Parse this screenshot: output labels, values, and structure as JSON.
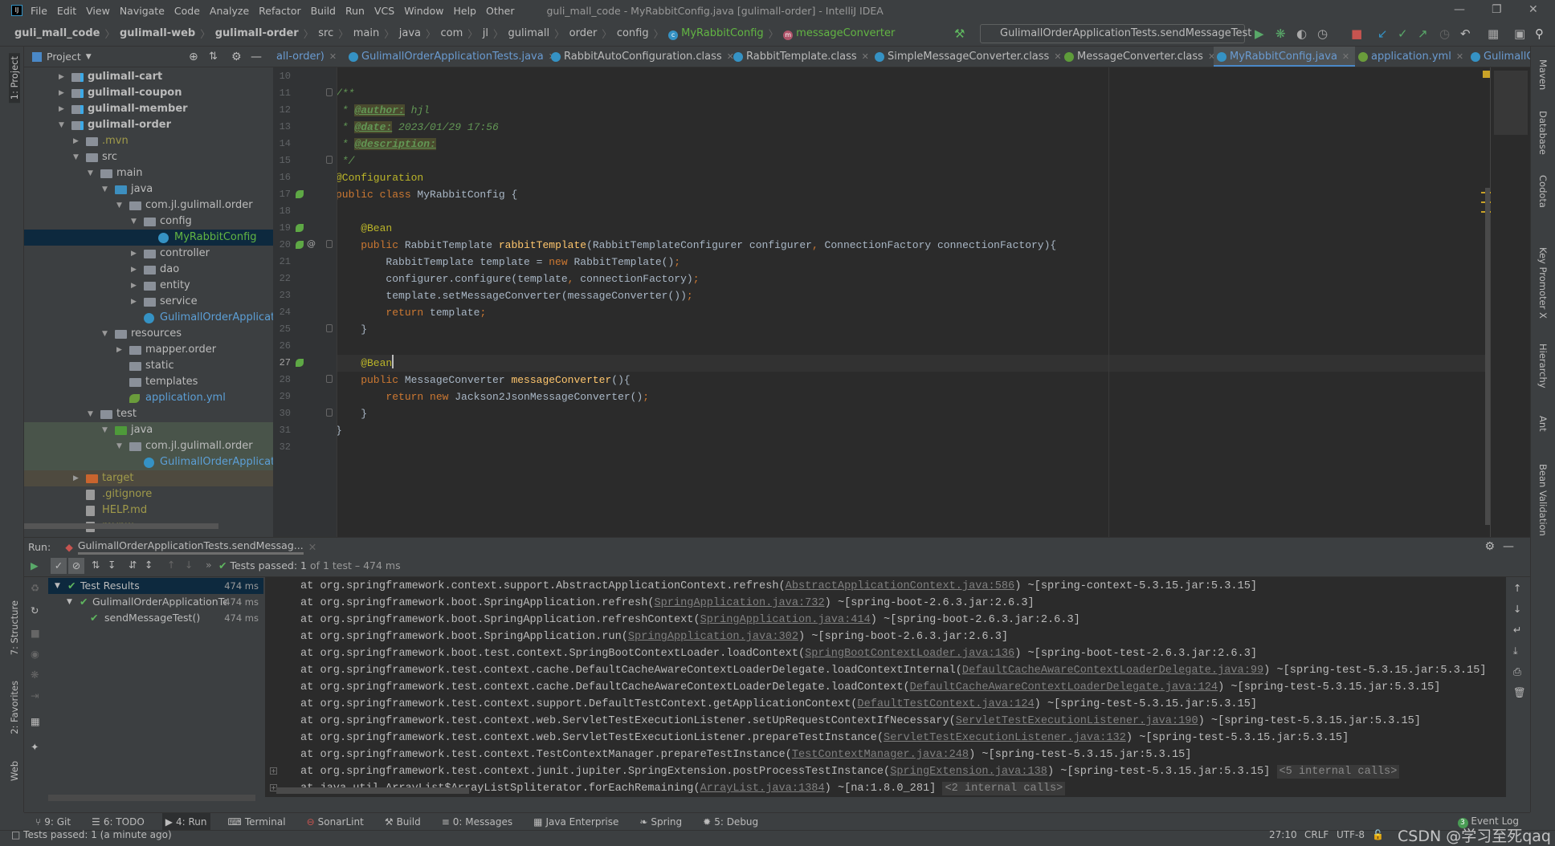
{
  "app": {
    "title": "guli_mall_code - MyRabbitConfig.java [gulimall-order] - IntelliJ IDEA",
    "logo": "IJ"
  },
  "menu": [
    "File",
    "Edit",
    "View",
    "Navigate",
    "Code",
    "Analyze",
    "Refactor",
    "Build",
    "Run",
    "VCS",
    "Window",
    "Help",
    "Other"
  ],
  "breadcrumb": [
    {
      "label": "guli_mall_code",
      "bold": true
    },
    {
      "label": "gulimall-web",
      "bold": true
    },
    {
      "label": "gulimall-order",
      "bold": true
    },
    {
      "label": "src"
    },
    {
      "label": "main"
    },
    {
      "label": "java"
    },
    {
      "label": "com"
    },
    {
      "label": "jl"
    },
    {
      "label": "gulimall"
    },
    {
      "label": "order"
    },
    {
      "label": "config"
    },
    {
      "label": "MyRabbitConfig",
      "icon": "class-icon"
    },
    {
      "label": "messageConverter",
      "icon": "method-icon"
    }
  ],
  "run_config": "GulimallOrderApplicationTests.sendMessageTest",
  "project": {
    "title": "Project",
    "tree": [
      {
        "label": "gulimall-cart",
        "depth": 0,
        "arrow": "right",
        "icon": "module",
        "bold": true
      },
      {
        "label": "gulimall-coupon",
        "depth": 0,
        "arrow": "right",
        "icon": "module",
        "bold": true
      },
      {
        "label": "gulimall-member",
        "depth": 0,
        "arrow": "right",
        "icon": "module",
        "bold": true
      },
      {
        "label": "gulimall-order",
        "depth": 0,
        "arrow": "down",
        "icon": "module",
        "bold": true
      },
      {
        "label": ".mvn",
        "depth": 1,
        "arrow": "right",
        "icon": "folder",
        "color": "#a09a4a"
      },
      {
        "label": "src",
        "depth": 1,
        "arrow": "down",
        "icon": "folder"
      },
      {
        "label": "main",
        "depth": 2,
        "arrow": "down",
        "icon": "folder"
      },
      {
        "label": "java",
        "depth": 3,
        "arrow": "down",
        "icon": "folder",
        "iconColor": "#3d8fbf"
      },
      {
        "label": "com.jl.gulimall.order",
        "depth": 4,
        "arrow": "down",
        "icon": "package"
      },
      {
        "label": "config",
        "depth": 5,
        "arrow": "down",
        "icon": "package"
      },
      {
        "label": "MyRabbitConfig",
        "depth": 6,
        "arrow": "",
        "icon": "class",
        "color": "#62b543",
        "selected": true
      },
      {
        "label": "controller",
        "depth": 5,
        "arrow": "right",
        "icon": "package"
      },
      {
        "label": "dao",
        "depth": 5,
        "arrow": "right",
        "icon": "package"
      },
      {
        "label": "entity",
        "depth": 5,
        "arrow": "right",
        "icon": "package"
      },
      {
        "label": "service",
        "depth": 5,
        "arrow": "right",
        "icon": "package"
      },
      {
        "label": "GulimallOrderApplication",
        "depth": 5,
        "arrow": "",
        "icon": "class",
        "color": "#5c9fd6"
      },
      {
        "label": "resources",
        "depth": 3,
        "arrow": "down",
        "icon": "folder"
      },
      {
        "label": "mapper.order",
        "depth": 4,
        "arrow": "right",
        "icon": "folder"
      },
      {
        "label": "static",
        "depth": 4,
        "arrow": "",
        "icon": "folder"
      },
      {
        "label": "templates",
        "depth": 4,
        "arrow": "",
        "icon": "folder"
      },
      {
        "label": "application.yml",
        "depth": 4,
        "arrow": "",
        "icon": "yml",
        "color": "#5c9fd6"
      },
      {
        "label": "test",
        "depth": 2,
        "arrow": "down",
        "icon": "folder"
      },
      {
        "label": "java",
        "depth": 3,
        "arrow": "down",
        "icon": "folder",
        "iconColor": "#4e9a3a",
        "bg": "#49544a"
      },
      {
        "label": "com.jl.gulimall.order",
        "depth": 4,
        "arrow": "down",
        "icon": "package",
        "bg": "#49544a"
      },
      {
        "label": "GulimallOrderApplication",
        "depth": 5,
        "arrow": "",
        "icon": "class",
        "color": "#5c9fd6",
        "bg": "#49544a"
      },
      {
        "label": "target",
        "depth": 1,
        "arrow": "right",
        "icon": "folder",
        "iconColor": "#c9642e",
        "color": "#a09a4a",
        "bg": "#4e4a3f"
      },
      {
        "label": ".gitignore",
        "depth": 1,
        "arrow": "",
        "icon": "file",
        "color": "#a09a4a"
      },
      {
        "label": "HELP.md",
        "depth": 1,
        "arrow": "",
        "icon": "file",
        "color": "#a09a4a"
      },
      {
        "label": "mvnw",
        "depth": 1,
        "arrow": "",
        "icon": "file",
        "color": "#a09a4a"
      }
    ]
  },
  "tabs": [
    {
      "label": "all-order)",
      "color": "#6a9bd1",
      "noicon": true
    },
    {
      "label": "GulimallOrderApplicationTests.java",
      "color": "#6a9bd1"
    },
    {
      "label": "RabbitAutoConfiguration.class"
    },
    {
      "label": "RabbitTemplate.class"
    },
    {
      "label": "SimpleMessageConverter.class"
    },
    {
      "label": "MessageConverter.class",
      "iconColor": "#5e9c3a"
    },
    {
      "label": "MyRabbitConfig.java",
      "active": true
    },
    {
      "label": "application.yml",
      "color": "#6a9bd1",
      "iconColor": "#6a9c3b"
    },
    {
      "label": "GulimallC",
      "color": "#6a9bd1",
      "nox": true
    }
  ],
  "editor": {
    "current_line": 27,
    "lines": [
      {
        "n": 10,
        "t": []
      },
      {
        "n": 11,
        "t": [
          [
            "cm",
            "/**"
          ]
        ]
      },
      {
        "n": 12,
        "t": [
          [
            "cm",
            " * "
          ],
          [
            "tag",
            "@author:"
          ],
          [
            "cm",
            " hjl"
          ]
        ]
      },
      {
        "n": 13,
        "t": [
          [
            "cm",
            " * "
          ],
          [
            "tag",
            "@date:"
          ],
          [
            "cm",
            " 2023/01/29 17:56"
          ]
        ]
      },
      {
        "n": 14,
        "t": [
          [
            "cm",
            " * "
          ],
          [
            "tag",
            "@description:"
          ]
        ]
      },
      {
        "n": 15,
        "t": [
          [
            "cm",
            " */"
          ]
        ]
      },
      {
        "n": 16,
        "t": [
          [
            "ann",
            "@Configuration"
          ]
        ]
      },
      {
        "n": 17,
        "t": [
          [
            "kw",
            "public class "
          ],
          [
            "df",
            "MyRabbitConfig {"
          ]
        ],
        "gicon": true
      },
      {
        "n": 18,
        "t": []
      },
      {
        "n": 19,
        "t": [
          [
            "ann",
            "    @Bean"
          ]
        ],
        "gicon": true
      },
      {
        "n": 20,
        "t": [
          [
            "kw",
            "    public "
          ],
          [
            "df",
            "RabbitTemplate "
          ],
          [
            "fn",
            "rabbitTemplate"
          ],
          [
            "df",
            "(RabbitTemplateConfigurer configurer"
          ],
          [
            "kw",
            ", "
          ],
          [
            "df",
            "ConnectionFactory connectionFactory){"
          ]
        ],
        "gicon": true
      },
      {
        "n": 21,
        "t": [
          [
            "df",
            "        RabbitTemplate template = "
          ],
          [
            "kw",
            "new "
          ],
          [
            "df",
            "RabbitTemplate()"
          ],
          [
            "kw",
            ";"
          ]
        ]
      },
      {
        "n": 22,
        "t": [
          [
            "df",
            "        configurer.configure(template"
          ],
          [
            "kw",
            ", "
          ],
          [
            "df",
            "connectionFactory)"
          ],
          [
            "kw",
            ";"
          ]
        ]
      },
      {
        "n": 23,
        "t": [
          [
            "df",
            "        template.setMessageConverter(messageConverter())"
          ],
          [
            "kw",
            ";"
          ]
        ]
      },
      {
        "n": 24,
        "t": [
          [
            "kw",
            "        return "
          ],
          [
            "df",
            "template"
          ],
          [
            "kw",
            ";"
          ]
        ]
      },
      {
        "n": 25,
        "t": [
          [
            "df",
            "    }"
          ]
        ]
      },
      {
        "n": 26,
        "t": []
      },
      {
        "n": 27,
        "t": [
          [
            "ann",
            "    @Bean"
          ]
        ],
        "gicon": true
      },
      {
        "n": 28,
        "t": [
          [
            "kw",
            "    public "
          ],
          [
            "df",
            "MessageConverter "
          ],
          [
            "fn",
            "messageConverter"
          ],
          [
            "df",
            "(){"
          ]
        ]
      },
      {
        "n": 29,
        "t": [
          [
            "kw",
            "        return new "
          ],
          [
            "df",
            "Jackson2JsonMessageConverter()"
          ],
          [
            "kw",
            ";"
          ]
        ]
      },
      {
        "n": 30,
        "t": [
          [
            "df",
            "    }"
          ]
        ]
      },
      {
        "n": 31,
        "t": [
          [
            "df",
            "}"
          ]
        ]
      },
      {
        "n": 32,
        "t": []
      }
    ]
  },
  "run": {
    "label": "Run:",
    "tab": "GulimallOrderApplicationTests.sendMessag...",
    "status_prefix": "Tests passed:",
    "status_count": "1",
    "status_rest": "of 1 test – 474 ms",
    "tree": [
      {
        "label": "Test Results",
        "time": "474 ms",
        "depth": 0,
        "arrow": true,
        "selected": true
      },
      {
        "label": "GulimallOrderApplicationTes",
        "time": "474 ms",
        "depth": 1,
        "arrow": true
      },
      {
        "label": "sendMessageTest()",
        "time": "474 ms",
        "depth": 2,
        "arrow": false
      }
    ],
    "console": [
      {
        "pre": "at org.springframework.context.support.AbstractApplicationContext.refresh(",
        "link": "AbstractApplicationContext.java:586",
        "post": ") ~[spring-context-5.3.15.jar:5.3.15]"
      },
      {
        "pre": "at org.springframework.boot.SpringApplication.refresh(",
        "link": "SpringApplication.java:732",
        "post": ") ~[spring-boot-2.6.3.jar:2.6.3]"
      },
      {
        "pre": "at org.springframework.boot.SpringApplication.refreshContext(",
        "link": "SpringApplication.java:414",
        "post": ") ~[spring-boot-2.6.3.jar:2.6.3]"
      },
      {
        "pre": "at org.springframework.boot.SpringApplication.run(",
        "link": "SpringApplication.java:302",
        "post": ") ~[spring-boot-2.6.3.jar:2.6.3]"
      },
      {
        "pre": "at org.springframework.boot.test.context.SpringBootContextLoader.loadContext(",
        "link": "SpringBootContextLoader.java:136",
        "post": ") ~[spring-boot-test-2.6.3.jar:2.6.3]"
      },
      {
        "pre": "at org.springframework.test.context.cache.DefaultCacheAwareContextLoaderDelegate.loadContextInternal(",
        "link": "DefaultCacheAwareContextLoaderDelegate.java:99",
        "post": ") ~[spring-test-5.3.15.jar:5.3.15]"
      },
      {
        "pre": "at org.springframework.test.context.cache.DefaultCacheAwareContextLoaderDelegate.loadContext(",
        "link": "DefaultCacheAwareContextLoaderDelegate.java:124",
        "post": ") ~[spring-test-5.3.15.jar:5.3.15]"
      },
      {
        "pre": "at org.springframework.test.context.support.DefaultTestContext.getApplicationContext(",
        "link": "DefaultTestContext.java:124",
        "post": ") ~[spring-test-5.3.15.jar:5.3.15]"
      },
      {
        "pre": "at org.springframework.test.context.web.ServletTestExecutionListener.setUpRequestContextIfNecessary(",
        "link": "ServletTestExecutionListener.java:190",
        "post": ") ~[spring-test-5.3.15.jar:5.3.15]"
      },
      {
        "pre": "at org.springframework.test.context.web.ServletTestExecutionListener.prepareTestInstance(",
        "link": "ServletTestExecutionListener.java:132",
        "post": ") ~[spring-test-5.3.15.jar:5.3.15]"
      },
      {
        "pre": "at org.springframework.test.context.TestContextManager.prepareTestInstance(",
        "link": "TestContextManager.java:248",
        "post": ") ~[spring-test-5.3.15.jar:5.3.15]"
      },
      {
        "pre": "at org.springframework.test.context.junit.jupiter.SpringExtension.postProcessTestInstance(",
        "link": "SpringExtension.java:138",
        "post": ") ~[spring-test-5.3.15.jar:5.3.15]",
        "note": "<5 internal calls>",
        "fold": true
      },
      {
        "pre": "at java.util.ArrayList$ArrayListSpliterator.forEachRemaining(",
        "link": "ArrayList.java:1384",
        "post": ") ~[na:1.8.0_281]",
        "note": "<2 internal calls>",
        "fold": true
      }
    ]
  },
  "bottom_tabs": [
    {
      "label": "9: Git"
    },
    {
      "label": "6: TODO"
    },
    {
      "label": "4: Run",
      "active": true
    },
    {
      "label": "Terminal"
    },
    {
      "label": "SonarLint"
    },
    {
      "label": "Build"
    },
    {
      "label": "0: Messages"
    },
    {
      "label": "Java Enterprise"
    },
    {
      "label": "Spring"
    },
    {
      "label": "5: Debug"
    }
  ],
  "event_log": {
    "count": "3",
    "label": "Event Log"
  },
  "left_strip": [
    "1: Project",
    "7: Structure",
    "2: Favorites",
    "Web"
  ],
  "right_strip": [
    "Maven",
    "Database",
    "Codota",
    "Key Promoter X",
    "Hierarchy",
    "Ant",
    "Bean Validation"
  ],
  "status": {
    "message": "Tests passed: 1 (a minute ago)",
    "position": "27:10",
    "line_sep": "CRLF",
    "encoding": "UTF-8"
  },
  "watermark": "CSDN @学习至死qaq"
}
